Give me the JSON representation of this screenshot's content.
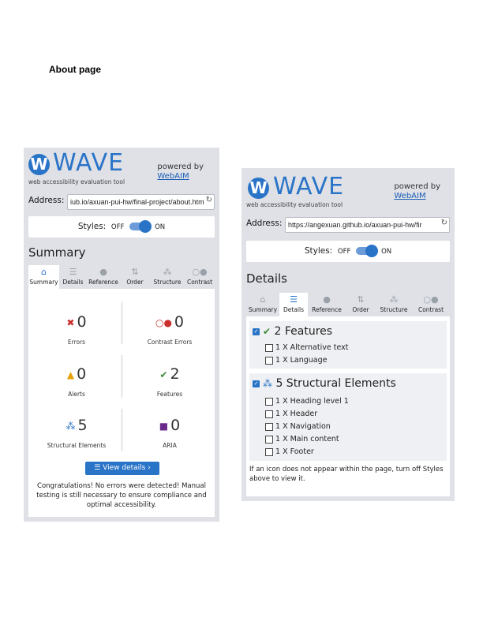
{
  "page": {
    "title": "About page"
  },
  "colors": {
    "brand": "#2a74c7",
    "error": "#c9302c",
    "alert": "#e6a100",
    "feature": "#3a8a3a",
    "aria": "#6a2a8a"
  },
  "panels": [
    {
      "logo_letter": "W",
      "logo_text": "WAVE",
      "tagline": "web accessibility evaluation tool",
      "powered_by": "powered by",
      "powered_link": "WebAIM",
      "address_label": "Address:",
      "address_value": "iub.io/axuan-pui-hw/final-project/about.html",
      "styles_label": "Styles:",
      "styles_off": "OFF",
      "styles_on": "ON",
      "section_title": "Summary",
      "tabs": [
        "Summary",
        "Details",
        "Reference",
        "Order",
        "Structure",
        "Contrast"
      ],
      "active_tab": "Summary",
      "stats": [
        {
          "icon": "error-icon",
          "value": "0",
          "label": "Errors"
        },
        {
          "icon": "contrast-icon",
          "value": "0",
          "label": "Contrast Errors"
        },
        {
          "icon": "alert-icon",
          "value": "0",
          "label": "Alerts"
        },
        {
          "icon": "feature-icon",
          "value": "2",
          "label": "Features"
        },
        {
          "icon": "structure-icon",
          "value": "5",
          "label": "Structural Elements"
        },
        {
          "icon": "aria-icon",
          "value": "0",
          "label": "ARIA"
        }
      ],
      "view_details": "View details ›",
      "congrats": "Congratulations! No errors were detected! Manual testing is still necessary to ensure compliance and optimal accessibility."
    },
    {
      "logo_letter": "W",
      "logo_text": "WAVE",
      "tagline": "web accessibility evaluation tool",
      "powered_by": "powered by",
      "powered_link": "WebAIM",
      "address_label": "Address:",
      "address_value": "https://angexuan.github.io/axuan-pui-hw/fir",
      "styles_label": "Styles:",
      "styles_off": "OFF",
      "styles_on": "ON",
      "section_title": "Details",
      "tabs": [
        "Summary",
        "Details",
        "Reference",
        "Order",
        "Structure",
        "Contrast"
      ],
      "active_tab": "Details",
      "features_title": "2 Features",
      "features": [
        "1 X Alternative text",
        "1 X Language"
      ],
      "structure_title": "5 Structural Elements",
      "structure": [
        "1 X Heading level 1",
        "1 X Header",
        "1 X Navigation",
        "1 X Main content",
        "1 X Footer"
      ],
      "note": "If an icon does not appear within the page, turn off Styles above to view it."
    }
  ]
}
